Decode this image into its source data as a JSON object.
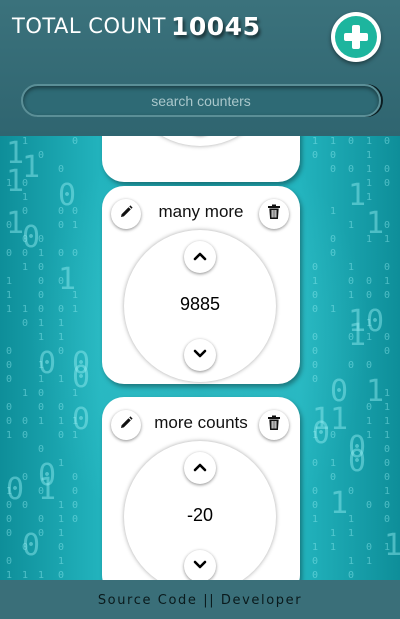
{
  "header": {
    "total_label": "TOTAL COUNT",
    "total_value": "10045",
    "add_icon": "plus-icon",
    "accent_color": "#1db59e"
  },
  "search": {
    "placeholder": "search counters",
    "value": ""
  },
  "counters": [
    {
      "name": "",
      "count": ""
    },
    {
      "name": "many more",
      "count": "9885"
    },
    {
      "name": "more counts",
      "count": "-20"
    }
  ],
  "icons": {
    "edit": "pencil-icon",
    "delete": "trash-icon",
    "increment": "chevron-up-icon",
    "decrement": "chevron-down-icon"
  },
  "footer": {
    "source_label": "Source Code",
    "separator": "||",
    "developer_label": "Developer"
  }
}
